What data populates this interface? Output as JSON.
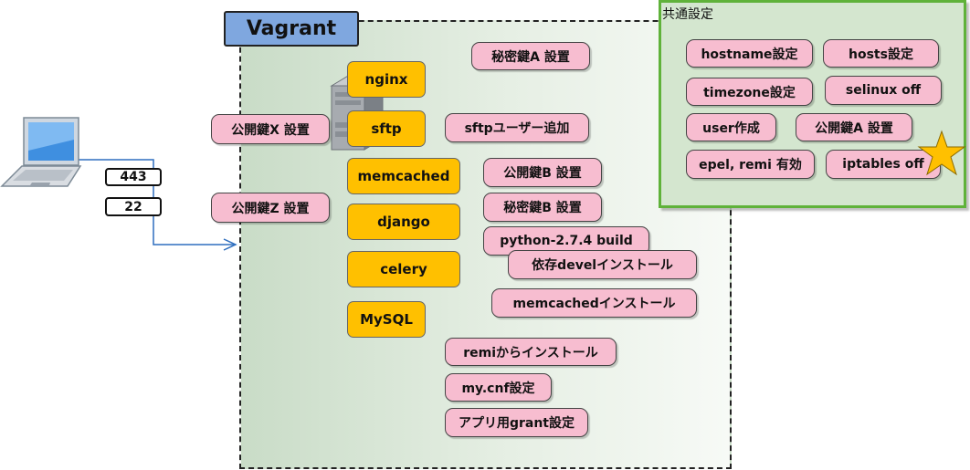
{
  "vagrant": {
    "title": "Vagrant"
  },
  "common": {
    "title": "共通設定",
    "items": {
      "hostname": "hostname設定",
      "hosts": "hosts設定",
      "timezone": "timezone設定",
      "selinux": "selinux off",
      "user": "user作成",
      "pubkey_a": "公開鍵A 設置",
      "epel": "epel, remi 有効",
      "iptables": "iptables off"
    }
  },
  "ports": {
    "https": "443",
    "ssh": "22"
  },
  "left_keys": {
    "pubkey_x": "公開鍵X 設置",
    "pubkey_z": "公開鍵Z 設置"
  },
  "services": {
    "nginx": "nginx",
    "sftp": "sftp",
    "memcached": "memcached",
    "django": "django",
    "celery": "celery",
    "mysql": "MySQL"
  },
  "tasks": {
    "privkey_a": "秘密鍵A 設置",
    "sftp_user": "sftpユーザー追加",
    "pubkey_b": "公開鍵B 設置",
    "privkey_b": "秘密鍵B 設置",
    "python_build": "python-2.7.4 build",
    "devel_install": "依存develインストール",
    "memcached_install": "memcachedインストール",
    "remi_install": "remiからインストール",
    "mycnf": "my.cnf設定",
    "grant": "アプリ用grant設定"
  },
  "colors": {
    "service": "#ffc000",
    "task": "#f7bdd0",
    "vagrant_title": "#7fa7df",
    "panel_border": "#5fb23a",
    "arrow": "#2f6fbf",
    "star": "#ffc000"
  },
  "icons": [
    "laptop-icon",
    "server-icon",
    "star-icon"
  ]
}
